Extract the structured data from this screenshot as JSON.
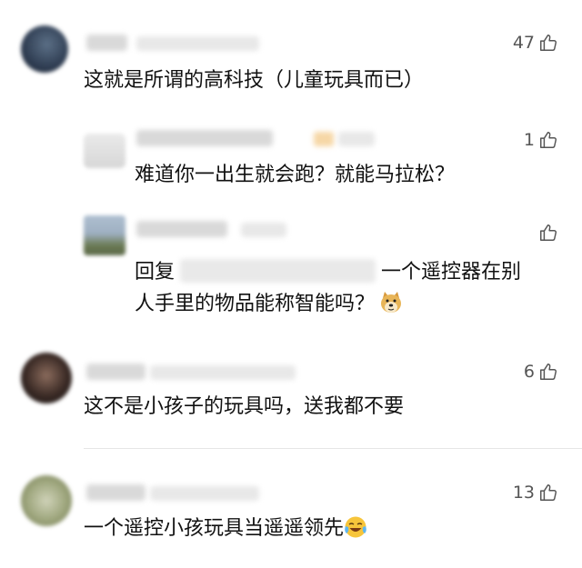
{
  "comments": [
    {
      "likes": "47",
      "text": "这就是所谓的高科技（儿童玩具而已）"
    },
    {
      "likes": "1",
      "text": "难道你一出生就会跑？就能马拉松？"
    },
    {
      "likes": "",
      "text_prefix": "回复",
      "text_line1_rest": "一个遥控器在别",
      "text_line2": "人手里的物品能称智能吗？"
    },
    {
      "likes": "6",
      "text": "这不是小孩子的玩具吗，送我都不要"
    },
    {
      "likes": "13",
      "text": "一个遥控小孩玩具当遥遥领先"
    }
  ],
  "icons": {
    "like": "thumbs-up-icon",
    "doge": "doge-emoji-icon",
    "cry_laugh": "laughing-crying-emoji-icon"
  },
  "colors": {
    "text": "#111111",
    "meta": "#555555",
    "divider": "#e6e6e6"
  }
}
